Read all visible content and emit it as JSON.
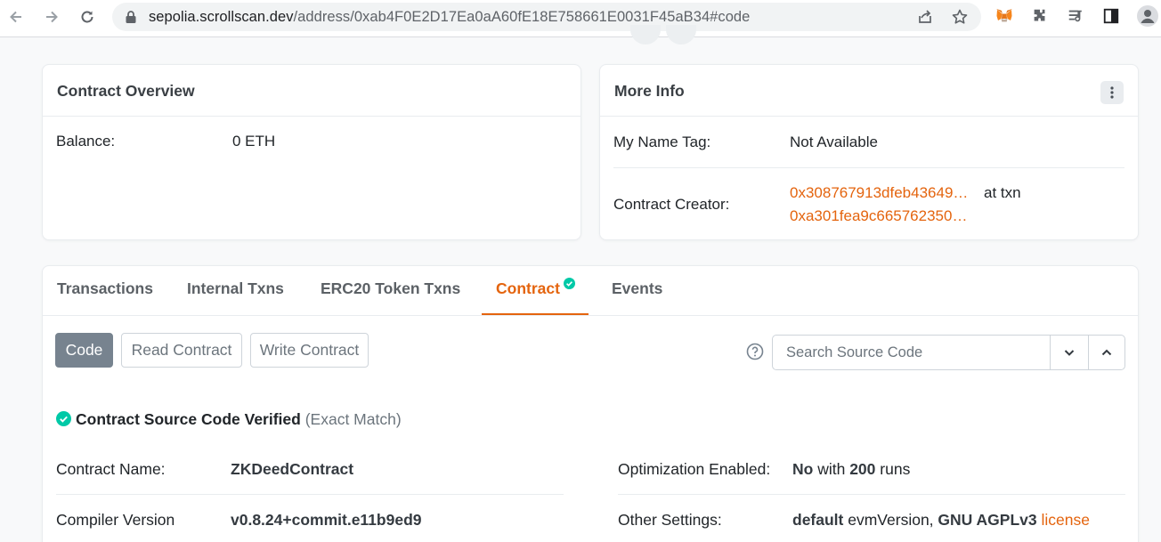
{
  "browser": {
    "url_host": "sepolia.scrollscan.dev",
    "url_path": "/address/0xab4F0E2D17Ea0aA60fE18E758661E0031F45aB34#code"
  },
  "overview": {
    "title": "Contract Overview",
    "balance_label": "Balance:",
    "balance_value": "0 ETH"
  },
  "more_info": {
    "title": "More Info",
    "name_tag_label": "My Name Tag:",
    "name_tag_value": "Not Available",
    "creator_label": "Contract Creator:",
    "creator_address": "0x308767913dfeb43649…",
    "creator_at_txn": "at txn",
    "creator_txn": "0xa301fea9c665762350…"
  },
  "tabs": [
    {
      "label": "Transactions"
    },
    {
      "label": "Internal Txns"
    },
    {
      "label": "ERC20 Token Txns"
    },
    {
      "label": "Contract"
    },
    {
      "label": "Events"
    }
  ],
  "code_tabs": {
    "code": "Code",
    "read": "Read Contract",
    "write": "Write Contract"
  },
  "search": {
    "placeholder": "Search Source Code"
  },
  "verified": {
    "title": "Contract Source Code Verified",
    "match": "(Exact Match)"
  },
  "details": {
    "contract_name_label": "Contract Name:",
    "contract_name_value": "ZKDeedContract",
    "compiler_label": "Compiler Version",
    "compiler_value": "v0.8.24+commit.e11b9ed9",
    "optimization_label": "Optimization Enabled:",
    "optimization_no": "No",
    "optimization_with": "with",
    "optimization_runs": "200",
    "optimization_runs_word": "runs",
    "other_settings_label": "Other Settings:",
    "other_default": "default",
    "other_evm": "evmVersion,",
    "other_license_name": "GNU AGPLv3",
    "other_license_link": "license"
  },
  "colors": {
    "accent": "#e4640e",
    "verified_green": "#00c9a7",
    "active_button": "#77838f"
  }
}
